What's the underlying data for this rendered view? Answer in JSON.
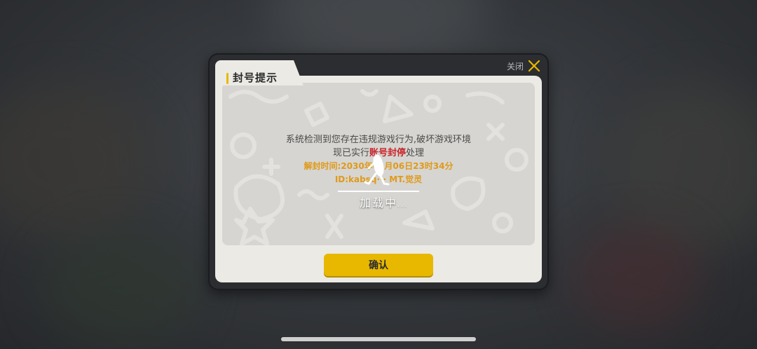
{
  "dialog": {
    "title": "封号提示",
    "close_label": "关闭",
    "message": {
      "line1": "系统检测到您存在违规游戏行为,破坏游戏环境",
      "line2_prefix": "现已实行",
      "line2_highlight": "账号封停",
      "line2_suffix": "处理",
      "unban_time": "解封时间:2030年01月06日23时34分",
      "account_id": "ID:kabsq··· MT.觉灵"
    },
    "confirm_label": "确认"
  },
  "loading": {
    "text": "加载中",
    "dots": "..."
  },
  "icons": {
    "close": "close-x-icon",
    "loader": "running-figure-icon"
  },
  "colors": {
    "accent": "#e8b800",
    "warning": "#c8252b",
    "info": "#e09a1a",
    "panel": "#eceae4",
    "frame": "#2b2d31"
  }
}
